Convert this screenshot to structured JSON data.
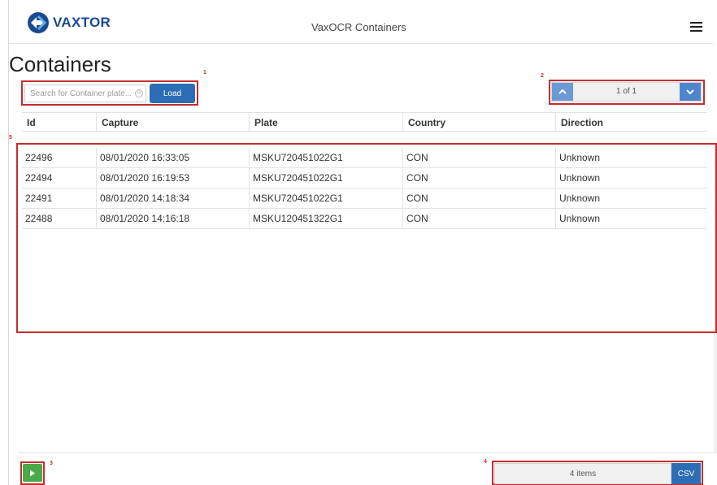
{
  "header": {
    "brand": "VAXTOR",
    "app_title": "VaxOCR Containers"
  },
  "page": {
    "title": "Containers"
  },
  "search": {
    "placeholder": "Search for Container plate...",
    "value": "",
    "load_label": "Load"
  },
  "pager": {
    "text": "1 of 1"
  },
  "table": {
    "columns": [
      "Id",
      "Capture",
      "Plate",
      "Country",
      "Direction"
    ],
    "rows": [
      [
        "22496",
        "08/01/2020 16:33:05",
        "MSKU720451022G1",
        "CON",
        "Unknown"
      ],
      [
        "22494",
        "08/01/2020 16:19:53",
        "MSKU720451022G1",
        "CON",
        "Unknown"
      ],
      [
        "22491",
        "08/01/2020 14:18:34",
        "MSKU720451022G1",
        "CON",
        "Unknown"
      ],
      [
        "22488",
        "08/01/2020 14:16:18",
        "MSKU120451322G1",
        "CON",
        "Unknown"
      ]
    ]
  },
  "footer": {
    "items_text": "4 items",
    "csv_label": "CSV"
  },
  "annotations": [
    "1",
    "2",
    "3",
    "4",
    "5"
  ],
  "colors": {
    "brand_blue": "#1a4a8f",
    "button_blue": "#2d6db4",
    "play_green": "#4aaa48",
    "annotation_red": "#c62d2d"
  },
  "icons": {
    "logo": "vaxtor-logo-icon",
    "menu": "hamburger-menu-icon",
    "clear": "clear-search-icon",
    "prev": "chevron-up-icon",
    "next": "chevron-down-icon",
    "play": "play-icon"
  }
}
